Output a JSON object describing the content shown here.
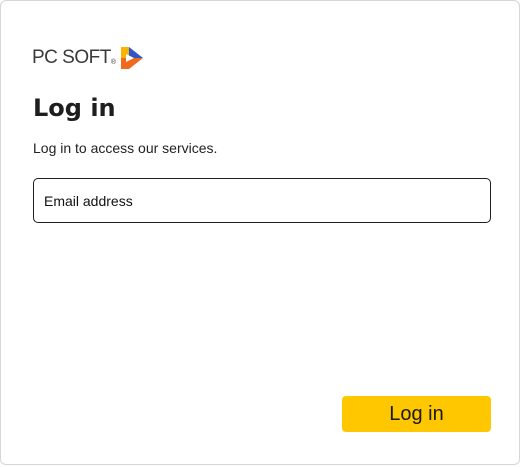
{
  "logo": {
    "wordmark": "PC SOFT",
    "registered": "®",
    "icon": "pcsoft-play-arrow-logo-icon",
    "colors": {
      "wordmark": "#3a3a3a",
      "blue": "#2f55c8",
      "orange": "#f06a1e",
      "yellow": "#f7b400"
    }
  },
  "header": {
    "title": "Log in",
    "subtitle": "Log in to access our services."
  },
  "form": {
    "email": {
      "placeholder": "Email address",
      "value": ""
    },
    "submit_label": "Log in"
  },
  "colors": {
    "accent": "#ffc700",
    "text": "#1e1e1e",
    "border": "#1e1e1e"
  }
}
